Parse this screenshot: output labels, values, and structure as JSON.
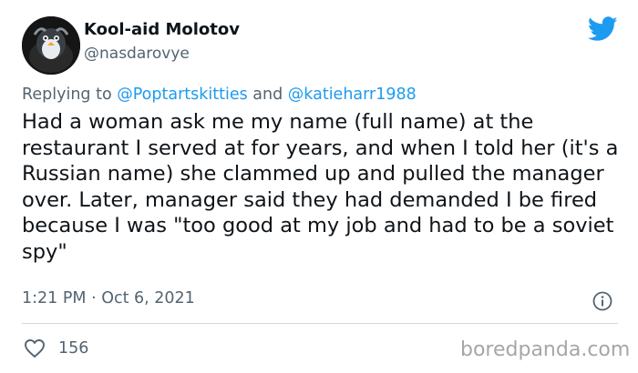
{
  "author": {
    "display_name": "Kool-aid Molotov",
    "handle": "@nasdarovye",
    "avatar_icon": "penguin-avatar"
  },
  "reply": {
    "prefix": "Replying to ",
    "mentions": [
      "@Poptartskitties",
      "@katieharr1988"
    ],
    "joiner": " and "
  },
  "tweet": {
    "text": "Had a woman ask me my name (full name) at the restaurant I served at for years, and when I told her (it's a Russian name) she clammed up and pulled the manager over. Later, manager said they had demanded I be fired because I was \"too good at my job and had to be a soviet spy\""
  },
  "meta": {
    "timestamp": "1:21 PM · Oct 6, 2021",
    "likes": "156"
  },
  "watermark": "boredpanda.com",
  "colors": {
    "twitter_blue": "#1d9bf0",
    "secondary_text": "#536471",
    "divider": "#cfd9de"
  }
}
